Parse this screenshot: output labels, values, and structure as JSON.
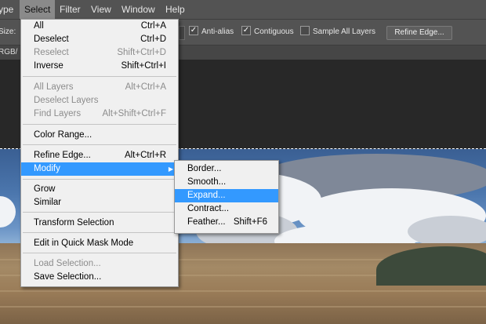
{
  "menubar": {
    "items": [
      "ype",
      "Select",
      "Filter",
      "View",
      "Window",
      "Help"
    ],
    "active": "Select"
  },
  "options_bar": {
    "size_label": "Size:",
    "anti_alias": "Anti-alias",
    "contiguous": "Contiguous",
    "sample_all_layers": "Sample All Layers",
    "refine_edge": "Refine Edge...",
    "anti_alias_checked": true,
    "contiguous_checked": true,
    "sample_all_checked": false
  },
  "document_tab": {
    "label": "RGB/"
  },
  "select_menu": {
    "items": [
      {
        "label": "All",
        "shortcut": "Ctrl+A",
        "disabled": false
      },
      {
        "label": "Deselect",
        "shortcut": "Ctrl+D",
        "disabled": false
      },
      {
        "label": "Reselect",
        "shortcut": "Shift+Ctrl+D",
        "disabled": true
      },
      {
        "label": "Inverse",
        "shortcut": "Shift+Ctrl+I",
        "disabled": false
      },
      {
        "label": "All Layers",
        "shortcut": "Alt+Ctrl+A",
        "disabled": true
      },
      {
        "label": "Deselect Layers",
        "shortcut": "",
        "disabled": true
      },
      {
        "label": "Find Layers",
        "shortcut": "Alt+Shift+Ctrl+F",
        "disabled": true
      },
      {
        "label": "Color Range...",
        "shortcut": "",
        "disabled": false
      },
      {
        "label": "Refine Edge...",
        "shortcut": "Alt+Ctrl+R",
        "disabled": false
      },
      {
        "label": "Modify",
        "shortcut": "",
        "disabled": false,
        "highlighted": true,
        "submenu": true
      },
      {
        "label": "Grow",
        "shortcut": "",
        "disabled": false
      },
      {
        "label": "Similar",
        "shortcut": "",
        "disabled": false
      },
      {
        "label": "Transform Selection",
        "shortcut": "",
        "disabled": false
      },
      {
        "label": "Edit in Quick Mask Mode",
        "shortcut": "",
        "disabled": false
      },
      {
        "label": "Load Selection...",
        "shortcut": "",
        "disabled": true
      },
      {
        "label": "Save Selection...",
        "shortcut": "",
        "disabled": false
      }
    ]
  },
  "modify_menu": {
    "items": [
      {
        "label": "Border...",
        "shortcut": ""
      },
      {
        "label": "Smooth...",
        "shortcut": ""
      },
      {
        "label": "Expand...",
        "shortcut": "",
        "highlighted": true
      },
      {
        "label": "Contract...",
        "shortcut": ""
      },
      {
        "label": "Feather...",
        "shortcut": "Shift+F6"
      }
    ]
  },
  "colors": {
    "menu_bg": "#f0f0f0",
    "highlight": "#3399ff",
    "chrome": "#535353"
  }
}
